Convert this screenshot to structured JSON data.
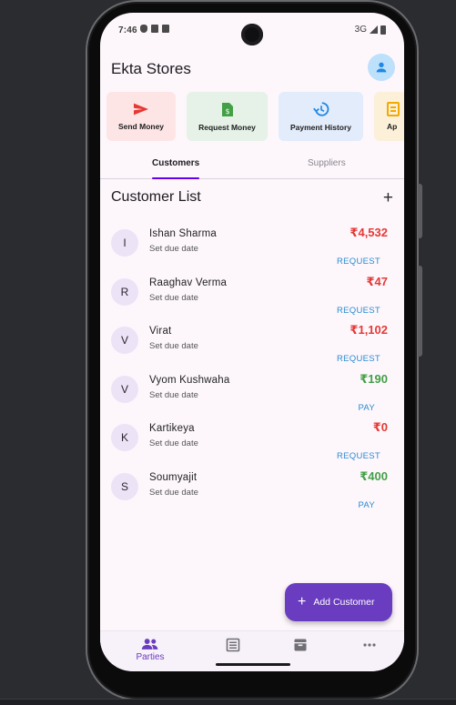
{
  "status_bar": {
    "time": "7:46",
    "network": "3G"
  },
  "app": {
    "title": "Ekta Stores",
    "profile_icon": "person-icon"
  },
  "quick_actions": [
    {
      "label": "Send Money",
      "icon": "send-icon",
      "color": "#e53935"
    },
    {
      "label": "Request Money",
      "icon": "document-dollar-icon",
      "color": "#43a047"
    },
    {
      "label": "Payment History",
      "icon": "history-icon",
      "color": "#1e88e5"
    },
    {
      "label": "Ap",
      "icon": "receipt-icon",
      "color": "#f2a900"
    }
  ],
  "tabs": {
    "customers": "Customers",
    "suppliers": "Suppliers",
    "active": "Customers"
  },
  "list": {
    "title": "Customer List",
    "customers": [
      {
        "initial": "I",
        "name": "Ishan Sharma",
        "due": "Set due date",
        "amount": "₹4,532",
        "status": "red",
        "action": "REQUEST"
      },
      {
        "initial": "R",
        "name": "Raaghav Verma",
        "due": "Set due date",
        "amount": "₹47",
        "status": "red",
        "action": "REQUEST"
      },
      {
        "initial": "V",
        "name": "Virat",
        "due": "Set due date",
        "amount": "₹1,102",
        "status": "red",
        "action": "REQUEST"
      },
      {
        "initial": "V",
        "name": "Vyom Kushwaha",
        "due": "Set due date",
        "amount": "₹190",
        "status": "green",
        "action": "PAY"
      },
      {
        "initial": "K",
        "name": "Kartikeya",
        "due": "Set due date",
        "amount": "₹0",
        "status": "red",
        "action": "REQUEST"
      },
      {
        "initial": "S",
        "name": "Soumyajit",
        "due": "Set due date",
        "amount": "₹400",
        "status": "green",
        "action": "PAY"
      }
    ]
  },
  "fab": {
    "label": "Add Customer"
  },
  "bottom_nav": {
    "items": [
      {
        "label": "Parties",
        "icon": "people-icon",
        "active": true
      },
      {
        "label": "",
        "icon": "receipt-list-icon"
      },
      {
        "label": "",
        "icon": "archive-icon"
      },
      {
        "label": "",
        "icon": "more-icon"
      }
    ]
  },
  "colors": {
    "primary": "#6a3cbf",
    "request": "#2a8bcf",
    "debit": "#e53935",
    "credit": "#43a047"
  }
}
